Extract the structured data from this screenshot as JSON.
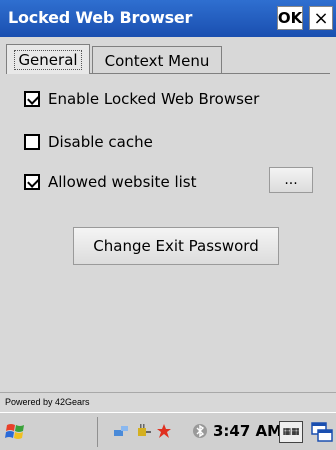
{
  "titlebar": {
    "title": "Locked Web Browser",
    "ok_label": "OK",
    "close_label": "×"
  },
  "tabs": [
    {
      "label": "General",
      "active": true
    },
    {
      "label": "Context Menu",
      "active": false
    }
  ],
  "options": [
    {
      "label": "Enable Locked Web Browser",
      "checked": true
    },
    {
      "label": "Disable cache",
      "checked": false
    },
    {
      "label": "Allowed website list",
      "checked": true
    }
  ],
  "buttons": {
    "ellipsis_label": "...",
    "change_password_label": "Change Exit Password"
  },
  "footer": {
    "powered_by": "Powered by 42Gears"
  },
  "taskbar": {
    "time": "3:47 AM"
  },
  "colors": {
    "titlebar": "#1f5cc4",
    "background": "#d8d8d8"
  }
}
